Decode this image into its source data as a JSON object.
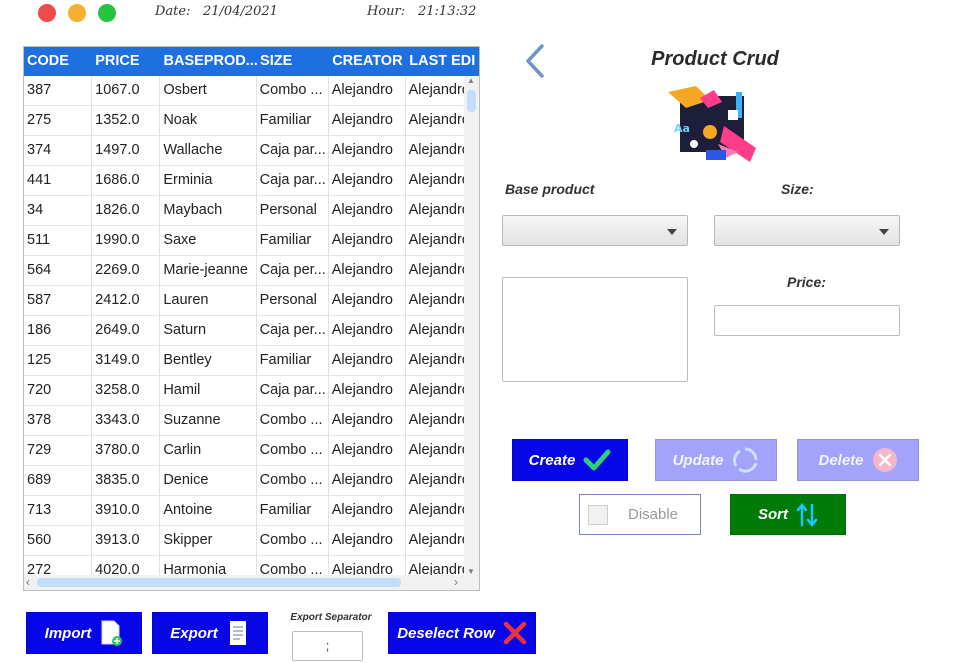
{
  "header": {
    "date_label": "Date:",
    "date_value": "21/04/2021",
    "hour_label": "Hour:",
    "hour_value": "21:13:32"
  },
  "table": {
    "columns": [
      "CODE",
      "PRICE",
      "BASEPROD...",
      "SIZE",
      "CREATOR",
      "LAST EDI"
    ],
    "rows": [
      [
        "387",
        "1067.0",
        "Osbert",
        "Combo ...",
        "Alejandro",
        "Alejandro"
      ],
      [
        "275",
        "1352.0",
        "Noak",
        "Familiar",
        "Alejandro",
        "Alejandro"
      ],
      [
        "374",
        "1497.0",
        "Wallache",
        "Caja par...",
        "Alejandro",
        "Alejandro"
      ],
      [
        "441",
        "1686.0",
        "Erminia",
        "Caja par...",
        "Alejandro",
        "Alejandro"
      ],
      [
        "34",
        "1826.0",
        "Maybach",
        "Personal",
        "Alejandro",
        "Alejandro"
      ],
      [
        "511",
        "1990.0",
        "Saxe",
        "Familiar",
        "Alejandro",
        "Alejandro"
      ],
      [
        "564",
        "2269.0",
        "Marie-jeanne",
        "Caja per...",
        "Alejandro",
        "Alejandro"
      ],
      [
        "587",
        "2412.0",
        "Lauren",
        "Personal",
        "Alejandro",
        "Alejandro"
      ],
      [
        "186",
        "2649.0",
        "Saturn",
        "Caja per...",
        "Alejandro",
        "Alejandro"
      ],
      [
        "125",
        "3149.0",
        "Bentley",
        "Familiar",
        "Alejandro",
        "Alejandro"
      ],
      [
        "720",
        "3258.0",
        "Hamil",
        "Caja par...",
        "Alejandro",
        "Alejandro"
      ],
      [
        "378",
        "3343.0",
        "Suzanne",
        "Combo ...",
        "Alejandro",
        "Alejandro"
      ],
      [
        "729",
        "3780.0",
        "Carlin",
        "Combo ...",
        "Alejandro",
        "Alejandro"
      ],
      [
        "689",
        "3835.0",
        "Denice",
        "Combo ...",
        "Alejandro",
        "Alejandro"
      ],
      [
        "713",
        "3910.0",
        "Antoine",
        "Familiar",
        "Alejandro",
        "Alejandro"
      ],
      [
        "560",
        "3913.0",
        "Skipper",
        "Combo ...",
        "Alejandro",
        "Alejandro"
      ],
      [
        "272",
        "4020.0",
        "Harmonia",
        "Combo ...",
        "Alejandro",
        "Alejandro"
      ]
    ]
  },
  "form": {
    "title": "Product Crud",
    "base_product_label": "Base product",
    "size_label": "Size:",
    "price_label": "Price:",
    "base_product_value": "",
    "size_value": "",
    "price_value": ""
  },
  "actions": {
    "create": "Create",
    "update": "Update",
    "delete": "Delete",
    "disable": "Disable",
    "sort": "Sort"
  },
  "footer": {
    "import": "Import",
    "export": "Export",
    "export_separator_label": "Export Separator",
    "export_separator_value": ";",
    "deselect": "Deselect Row"
  },
  "colors": {
    "header_blue": "#1e6fe0",
    "button_blue": "#0606e6",
    "button_disabled": "#a3a3fb",
    "button_green": "#007a07"
  }
}
